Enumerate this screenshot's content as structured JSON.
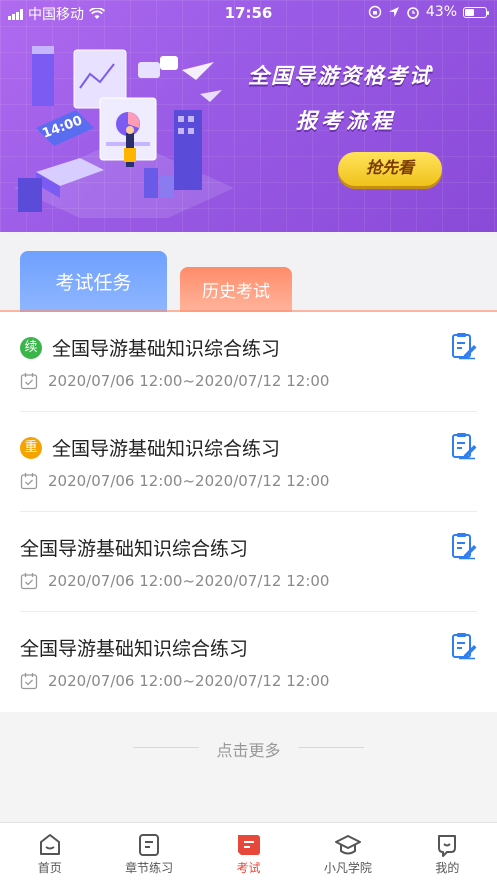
{
  "status_bar": {
    "carrier": "中国移动",
    "time": "17:56",
    "battery": "43%",
    "battery_level": 0.43
  },
  "banner": {
    "title": "全国导游资格考试",
    "subtitle": "报考流程",
    "button": "抢先看",
    "clock_text": "14:00"
  },
  "tabs": {
    "active": "考试任务",
    "history": "历史考试"
  },
  "exams": [
    {
      "title": "全国导游基础知识综合练习",
      "badge": "续",
      "badge_color": "#39b54a",
      "time": "2020/07/06 12:00~2020/07/12 12:00"
    },
    {
      "title": "全国导游基础知识综合练习",
      "badge": "重",
      "badge_color": "#f4a300",
      "time": "2020/07/06 12:00~2020/07/12 12:00"
    },
    {
      "title": "全国导游基础知识综合练习",
      "badge": "",
      "time": "2020/07/06 12:00~2020/07/12 12:00"
    },
    {
      "title": "全国导游基础知识综合练习",
      "badge": "",
      "time": "2020/07/06 12:00~2020/07/12 12:00"
    }
  ],
  "more": "点击更多",
  "nav": {
    "home": "首页",
    "chapter": "章节练习",
    "exam": "考试",
    "academy": "小凡学院",
    "mine": "我的",
    "active_color": "#e8483a"
  }
}
